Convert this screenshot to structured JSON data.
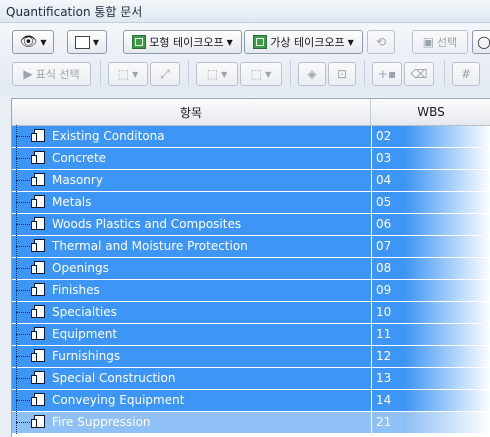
{
  "window": {
    "title": "Quantification 통합 문서"
  },
  "toolbar": {
    "view_button": {
      "icon": "eye-icon"
    },
    "layout_button": {
      "icon": "panel-icon"
    },
    "model_takeoff": {
      "label": "모형 테이크오프",
      "icon": "green-takeoff-icon"
    },
    "virtual_takeoff": {
      "label": "가상 테이크오프",
      "icon": "green-takeoff-icon"
    },
    "sync_button": {
      "icon": "sync-icon"
    },
    "select_button": {
      "label": "선택",
      "icon": "cube-select-icon"
    },
    "search_button": {
      "icon": "magnifier-icon"
    },
    "select_marker": {
      "label": "표식 선택",
      "icon": "arrow-cursor-icon"
    },
    "tools": [
      {
        "name": "polygon-icon"
      },
      {
        "name": "line-measure-icon"
      },
      {
        "name": "area-icon"
      },
      {
        "name": "area-dropdown-icon"
      },
      {
        "name": "fill-bucket-icon"
      },
      {
        "name": "region-select-icon"
      },
      {
        "name": "add-point-icon"
      },
      {
        "name": "eraser-icon"
      },
      {
        "name": "hash-icon"
      }
    ]
  },
  "grid": {
    "columns": [
      "항목",
      "WBS"
    ],
    "rows": [
      {
        "name": "Existing Conditona",
        "code": "02"
      },
      {
        "name": "Concrete",
        "code": "03"
      },
      {
        "name": "Masonry",
        "code": "04"
      },
      {
        "name": "Metals",
        "code": "05"
      },
      {
        "name": "Woods Plastics and Composites",
        "code": "06"
      },
      {
        "name": "Thermal and Moisture Protection",
        "code": "07"
      },
      {
        "name": "Openings",
        "code": "08"
      },
      {
        "name": "Finishes",
        "code": "09"
      },
      {
        "name": "Specialties",
        "code": "10"
      },
      {
        "name": "Equipment",
        "code": "11"
      },
      {
        "name": "Furnishings",
        "code": "12"
      },
      {
        "name": "Special Construction",
        "code": "13"
      },
      {
        "name": "Conveying Equipment",
        "code": "14"
      },
      {
        "name": "Fire Suppression",
        "code": "21"
      }
    ]
  }
}
